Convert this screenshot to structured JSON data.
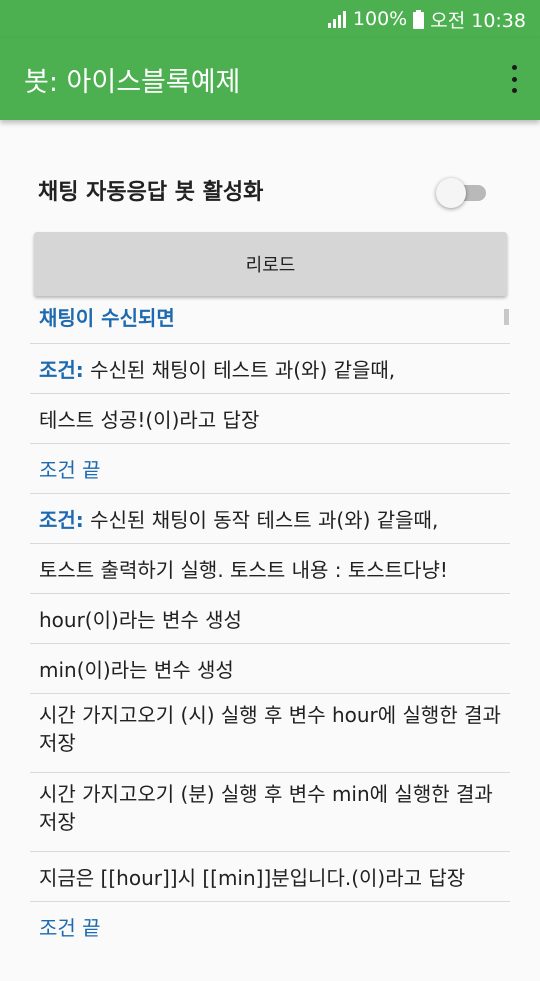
{
  "status_bar": {
    "battery_pct": "100%",
    "time": "오전 10:38",
    "icons": [
      "signal-icon",
      "battery-icon"
    ]
  },
  "app_bar": {
    "title": "봇: 아이스블록예제",
    "menu_icon": "more-vert-icon"
  },
  "settings": {
    "toggle_label": "채팅 자동응답 봇 활성화",
    "toggle_on": false,
    "reload_label": "리로드"
  },
  "script": {
    "header": "채팅이 수신되면",
    "items": [
      {
        "prefix": "조건:",
        "text": " 수신된 채팅이 테스트 과(와) 같을때,"
      },
      {
        "prefix": "",
        "text": "테스트 성공!(이)라고 답장"
      },
      {
        "prefix": "",
        "text": "조건 끝"
      },
      {
        "prefix": "조건:",
        "text": " 수신된 채팅이 동작 테스트 과(와) 같을때,"
      },
      {
        "prefix": "",
        "text": "토스트 출력하기 실행. 토스트 내용 : 토스트다냥!"
      },
      {
        "prefix": "",
        "text": "hour(이)라는 변수 생성"
      },
      {
        "prefix": "",
        "text": "min(이)라는 변수 생성"
      },
      {
        "prefix": "",
        "text": "시간 가지고오기 (시) 실행 후 변수 hour에 실행한 결과 저장"
      },
      {
        "prefix": "",
        "text": "시간 가지고오기 (분) 실행 후 변수 min에 실행한 결과 저장"
      },
      {
        "prefix": "",
        "text": "지금은 [[hour]]시 [[min]]분입니다.(이)라고 답장"
      },
      {
        "prefix": "",
        "text": "조건 끝"
      }
    ]
  },
  "colors": {
    "primary": "#4caf50",
    "link_blue": "#1e6ab0",
    "button_grey": "#d6d6d6"
  }
}
